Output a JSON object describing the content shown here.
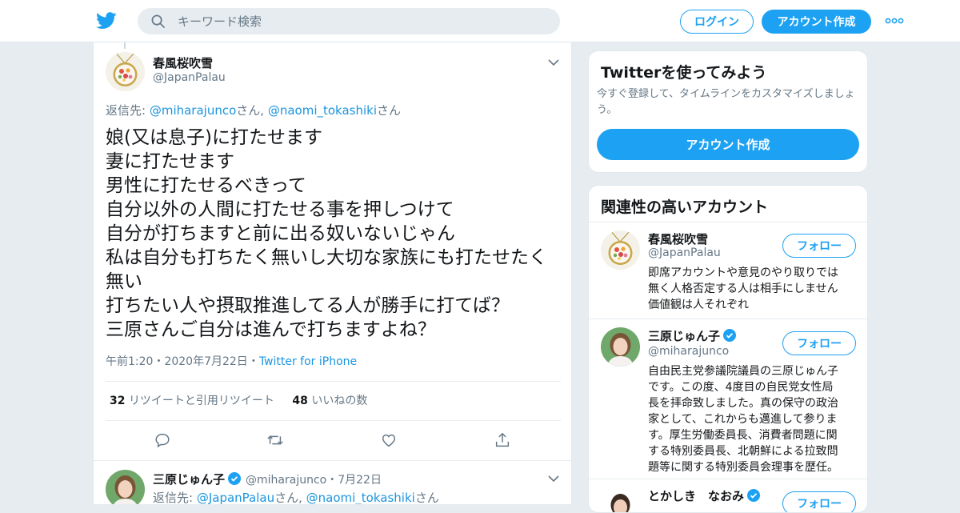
{
  "header": {
    "search_placeholder": "キーワード検索",
    "login_label": "ログイン",
    "signup_label": "アカウント作成",
    "accent": "#1da1f2"
  },
  "tweet": {
    "display_name": "春風桜吹雪",
    "handle": "@JapanPalau",
    "reply_prefix": "返信先: ",
    "reply_user1": "@miharajunco",
    "reply_san1": "さん, ",
    "reply_user2": "@naomi_tokashiki",
    "reply_san2": "さん",
    "lines": [
      "娘(又は息子)に打たせます",
      "妻に打たせます",
      "男性に打たせるべきって",
      "自分以外の人間に打たせる事を押しつけて",
      "自分が打ちますと前に出る奴いないじゃん",
      "私は自分も打ちたく無いし大切な家族にも打たせたく",
      "無い",
      "打ちたい人や摂取推進してる人が勝手に打てば？",
      "三原さんご自分は進んで打ちますよね？"
    ],
    "time": "午前1:20",
    "sep": "・",
    "date": "2020年7月22日",
    "source": "Twitter for iPhone",
    "retweet_count": "32",
    "retweet_label": "リツイートと引用リツイート",
    "like_count": "48",
    "like_label": "いいねの数"
  },
  "reply_tweet": {
    "display_name": "三原じゅん子",
    "handle": "@miharajunco",
    "date": "7月22日",
    "sep": "・",
    "reply_prefix": "返信先: ",
    "reply_user1": "@JapanPalau",
    "reply_san1": "さん, ",
    "reply_user2": "@naomi_tokashiki",
    "reply_san2": "さん"
  },
  "signup_card": {
    "title": "Twitterを使ってみよう",
    "subtitle_lines": [
      "今すぐ登録して、タイムラインをカスタマイズしましょ",
      "う。"
    ],
    "button_label": "アカウント作成"
  },
  "related": {
    "title": "関連性の高いアカウント",
    "follow_label": "フォロー",
    "accounts": [
      {
        "name": "春風桜吹雪",
        "handle": "@JapanPalau",
        "bio_lines": [
          "即席アカウントや意見のやり取りでは",
          "無く人格否定する人は相手にしません",
          "価値観は人それぞれ"
        ]
      },
      {
        "name": "三原じゅん子",
        "handle": "@miharajunco",
        "bio_lines": [
          "自由民主党参議院議員の三原じゅん子",
          "です。この度、4度目の自民党女性局",
          "長を拝命致しました。真の保守の政治",
          "家として、これからも邁進して参りま",
          "す。厚生労働委員長、消費者問題に関",
          "する特別委員長、北朝鮮による拉致問",
          "題等に関する特別委員会理事を歴任。"
        ]
      },
      {
        "name": "とかしき　なおみ",
        "handle": "",
        "bio_lines": []
      }
    ]
  }
}
